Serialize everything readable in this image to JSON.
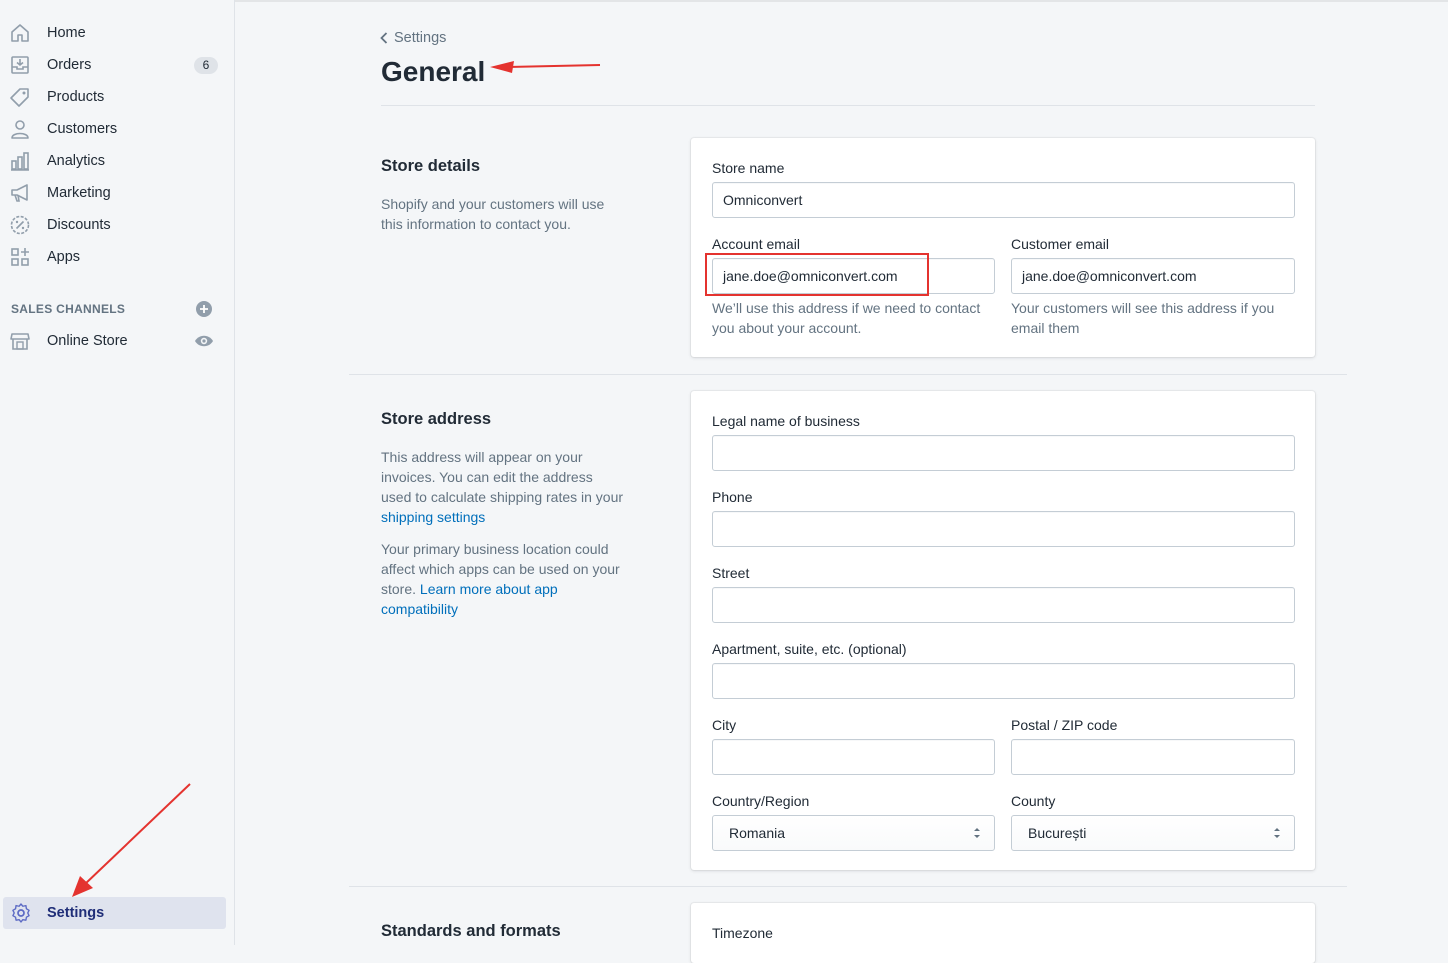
{
  "sidebar": {
    "items": [
      {
        "label": "Home",
        "icon": "home-icon"
      },
      {
        "label": "Orders",
        "icon": "orders-icon",
        "badge": "6"
      },
      {
        "label": "Products",
        "icon": "tag-icon"
      },
      {
        "label": "Customers",
        "icon": "person-icon"
      },
      {
        "label": "Analytics",
        "icon": "bar-chart-icon"
      },
      {
        "label": "Marketing",
        "icon": "megaphone-icon"
      },
      {
        "label": "Discounts",
        "icon": "percent-badge-icon"
      },
      {
        "label": "Apps",
        "icon": "apps-grid-icon"
      }
    ],
    "sales_channels_heading": "SALES CHANNELS",
    "online_store": "Online Store",
    "settings": "Settings"
  },
  "header": {
    "breadcrumb": "Settings",
    "title": "General"
  },
  "store_details": {
    "title": "Store details",
    "description": "Shopify and your customers will use this information to contact you.",
    "store_name_label": "Store name",
    "store_name_value": "Omniconvert",
    "account_email_label": "Account email",
    "account_email_value": "jane.doe@omniconvert.com",
    "account_email_help": "We’ll use this address if we need to contact you about your account.",
    "customer_email_label": "Customer email",
    "customer_email_value": "jane.doe@omniconvert.com",
    "customer_email_help": "Your customers will see this address if you email them"
  },
  "store_address": {
    "title": "Store address",
    "desc1_prefix": "This address will appear on your invoices. You can edit the address used to calculate shipping rates in your ",
    "desc1_link": "shipping settings",
    "desc2_prefix": "Your primary business location could affect which apps can be used on your store. ",
    "desc2_link": "Learn more about app compatibility",
    "legal_name_label": "Legal name of business",
    "phone_label": "Phone",
    "street_label": "Street",
    "apartment_label": "Apartment, suite, etc. (optional)",
    "city_label": "City",
    "postal_label": "Postal / ZIP code",
    "country_label": "Country/Region",
    "country_value": "Romania",
    "county_label": "County",
    "county_value": "București"
  },
  "standards": {
    "title": "Standards and formats",
    "timezone_label": "Timezone"
  },
  "colors": {
    "annotation_red": "#e4332f",
    "link_blue": "#006fbb",
    "settings_active": "#202e78"
  }
}
